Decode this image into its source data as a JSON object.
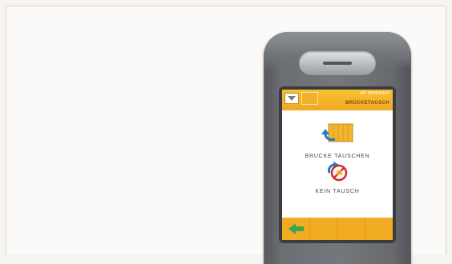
{
  "device_screen": {
    "header": {
      "small_text": "HH HHHHHHH",
      "title": "BRÜCKETAUSCH",
      "menu_icon": "dropdown-triangle-icon",
      "tab_icon": "blank-tab-icon"
    },
    "options": [
      {
        "label": "BRUCKE TAUSCHEN",
        "icon": "container-swap-icon"
      },
      {
        "label": "KEIN TAUSCH",
        "icon": "no-swap-icon"
      }
    ],
    "footer": {
      "back_icon": "back-arrow-icon"
    }
  },
  "colors": {
    "accent": "#f2ac24",
    "device_body": "#6b6e72",
    "back_arrow": "#3aa84a",
    "swap_arrow": "#1f7ac8",
    "prohibit_red": "#d9262c"
  }
}
